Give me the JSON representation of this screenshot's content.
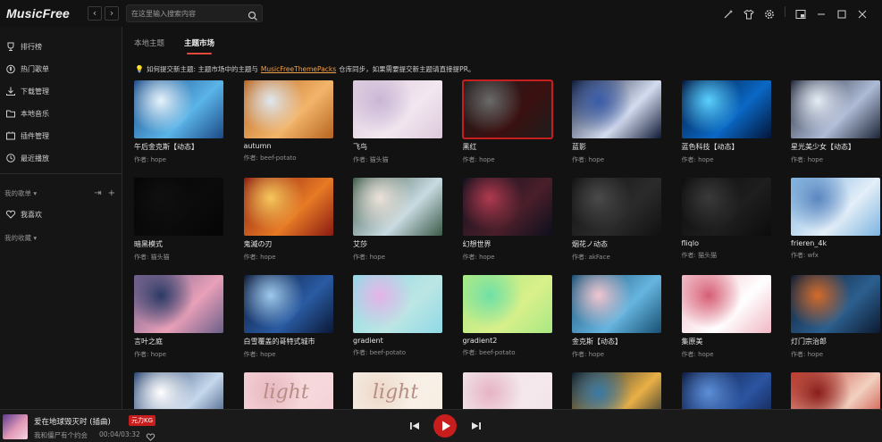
{
  "app": {
    "title": "MusicFree",
    "search_placeholder": "在这里输入搜索内容"
  },
  "sidebar": {
    "items": [
      {
        "label": "排行榜",
        "icon": "trophy-icon"
      },
      {
        "label": "热门歌单",
        "icon": "fire-icon"
      },
      {
        "label": "下载管理",
        "icon": "download-icon"
      },
      {
        "label": "本地音乐",
        "icon": "folder-icon"
      },
      {
        "label": "插件管理",
        "icon": "plugin-icon"
      },
      {
        "label": "最近播放",
        "icon": "history-icon"
      }
    ],
    "my_playlists": "我的歌单",
    "favorites": "我喜欢",
    "my_collections": "我的收藏"
  },
  "tabs": [
    {
      "label": "本地主题",
      "active": false
    },
    {
      "label": "主题市场",
      "active": true
    }
  ],
  "tip": {
    "before": "如何提交新主题: 主题市场中的主题与",
    "link": "MusicFreeThemePacks",
    "after": "仓库同步，如果需要提交新主题请直接提PR。"
  },
  "themes": [
    {
      "name": "午后金克斯【动态】",
      "author": "作者: hope",
      "colors": [
        "#1c4a86",
        "#5ab4e8",
        "#e7f3fb"
      ]
    },
    {
      "name": "autumn",
      "author": "作者: beef-potato",
      "colors": [
        "#b6641f",
        "#f3b56b",
        "#dfe7ef"
      ]
    },
    {
      "name": "飞鸟",
      "author": "作者: 猫头猫",
      "colors": [
        "#dcc9dc",
        "#f2e7f0",
        "#c9b6d6"
      ]
    },
    {
      "name": "黑红",
      "author": "作者: hope",
      "colors": [
        "#1d1d1d",
        "#3b1010",
        "#6a6a6a"
      ],
      "selected": true
    },
    {
      "name": "蓝影",
      "author": "作者: hope",
      "colors": [
        "#0f1a36",
        "#d4dcef",
        "#3a5ca8"
      ]
    },
    {
      "name": "蓝色科技【动态】",
      "author": "作者: hope",
      "colors": [
        "#03153a",
        "#0a68c4",
        "#5ad0ff"
      ]
    },
    {
      "name": "星光美少女【动态】",
      "author": "作者: hope",
      "colors": [
        "#1e2637",
        "#aebbd6",
        "#e5ecf5"
      ]
    },
    {
      "name": "暗黑模式",
      "author": "作者: 猫头猫",
      "colors": [
        "#050505",
        "#0b0b0b",
        "#101010"
      ]
    },
    {
      "name": "鬼滅の刃",
      "author": "作者: hope",
      "colors": [
        "#8a1a12",
        "#e67a25",
        "#f6c75c"
      ]
    },
    {
      "name": "艾莎",
      "author": "作者: hope",
      "colors": [
        "#3b5a48",
        "#c9dbe2",
        "#ece2d9"
      ]
    },
    {
      "name": "幻想世界",
      "author": "作者: hope",
      "colors": [
        "#0d0f1d",
        "#4a1f2a",
        "#b03a4e"
      ]
    },
    {
      "name": "烟花ノ动态",
      "author": "作者: akFace",
      "colors": [
        "#111111",
        "#2b2b2b",
        "#4a4a4a"
      ]
    },
    {
      "name": "fliqlo",
      "author": "作者: 猫头猫",
      "colors": [
        "#0c0c0c",
        "#1e1e1e",
        "#3a3a3a"
      ]
    },
    {
      "name": "frieren_4k",
      "author": "作者: wfx",
      "colors": [
        "#7db3df",
        "#e3eef8",
        "#5a86c0"
      ]
    },
    {
      "name": "言叶之庭",
      "author": "作者: hope",
      "colors": [
        "#6b5f8a",
        "#e9a0b8",
        "#2a3a66"
      ]
    },
    {
      "name": "白雪覆盖的哥特式城市",
      "author": "作者: hope",
      "colors": [
        "#0b1836",
        "#2a5ba3",
        "#9fc9ec"
      ]
    },
    {
      "name": "gradient",
      "author": "作者: beef-potato",
      "colors": [
        "#8fd9e6",
        "#bce6e4",
        "#e5b3e8"
      ]
    },
    {
      "name": "gradient2",
      "author": "作者: beef-potato",
      "colors": [
        "#a8e884",
        "#d9f08a",
        "#6fe0a6"
      ]
    },
    {
      "name": "金克斯【动态】",
      "author": "作者: hope",
      "colors": [
        "#174f72",
        "#66b5e0",
        "#f1c6cf"
      ]
    },
    {
      "name": "集原美",
      "author": "作者: hope",
      "colors": [
        "#f0b7c4",
        "#ffffff",
        "#d65e74"
      ]
    },
    {
      "name": "灯门宗治郎",
      "author": "作者: hope",
      "colors": [
        "#0c1a30",
        "#2c5f8f",
        "#d46b2a"
      ]
    },
    {
      "name": "",
      "author": "",
      "colors": [
        "#27426f",
        "#c6d8ec",
        "#ffffff"
      ]
    },
    {
      "name": "",
      "author": "",
      "colors": [
        "#f3cdd3",
        "#f6d9dc",
        "#e7b7bf"
      ],
      "label": "light"
    },
    {
      "name": "",
      "author": "",
      "colors": [
        "#f4eadf",
        "#f8f0e6",
        "#ecd8c8"
      ],
      "label": "light"
    },
    {
      "name": "",
      "author": "",
      "colors": [
        "#efe1e6",
        "#f5e8ec",
        "#e6b3c4"
      ]
    },
    {
      "name": "",
      "author": "",
      "colors": [
        "#0d1d2c",
        "#e9b046",
        "#3a7aa5"
      ]
    },
    {
      "name": "",
      "author": "",
      "colors": [
        "#0d1a3f",
        "#2b54a1",
        "#5d8fd8"
      ]
    },
    {
      "name": "",
      "author": "",
      "colors": [
        "#c13a2c",
        "#f2d0c0",
        "#8a1e1a"
      ]
    }
  ],
  "player": {
    "song": "爱在地球毁灭时 (插曲)",
    "quality": "元力KG",
    "singer": "我和僵尸有个约会",
    "time": "00:04/03:32"
  }
}
